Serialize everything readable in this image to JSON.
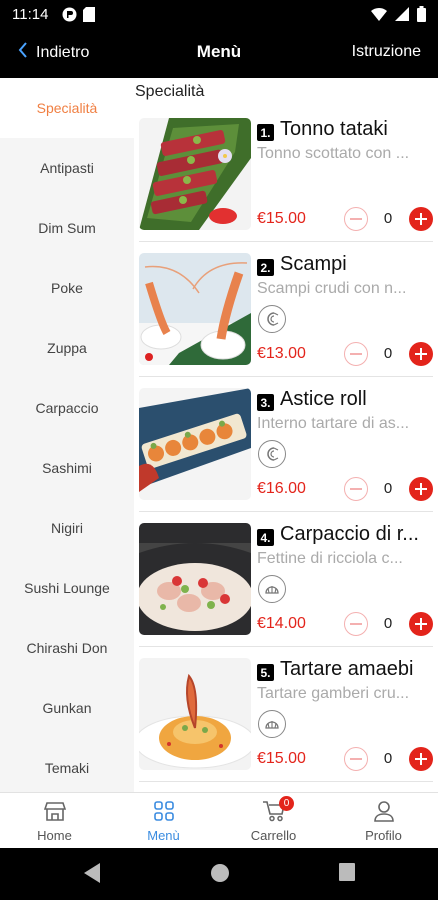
{
  "status_bar": {
    "time": "11:14"
  },
  "header": {
    "back_label": "Indietro",
    "title": "Menù",
    "instructions_label": "Istruzione"
  },
  "sidebar": {
    "items": [
      {
        "label": "Specialità"
      },
      {
        "label": "Antipasti"
      },
      {
        "label": "Dim Sum"
      },
      {
        "label": "Poke"
      },
      {
        "label": "Zuppa"
      },
      {
        "label": "Carpaccio"
      },
      {
        "label": "Sashimi"
      },
      {
        "label": "Nigiri"
      },
      {
        "label": "Sushi Lounge"
      },
      {
        "label": "Chirashi Don"
      },
      {
        "label": "Gunkan"
      },
      {
        "label": "Temaki"
      }
    ]
  },
  "main": {
    "section_title": "Specialità",
    "dishes": [
      {
        "number": "1.",
        "name": "Tonno tataki",
        "description": "Tonno scottato con ...",
        "price": "€15.00",
        "quantity": "0",
        "allergen_icon": ""
      },
      {
        "number": "2.",
        "name": "Scampi",
        "description": "Scampi crudi con n...",
        "price": "€13.00",
        "quantity": "0",
        "allergen_icon": "crustacean-icon"
      },
      {
        "number": "3.",
        "name": "Astice roll",
        "description": "Interno tartare di as...",
        "price": "€16.00",
        "quantity": "0",
        "allergen_icon": "crustacean-icon"
      },
      {
        "number": "4.",
        "name": "Carpaccio di r...",
        "description": "Fettine di ricciola c...",
        "price": "€14.00",
        "quantity": "0",
        "allergen_icon": "shell-icon"
      },
      {
        "number": "5.",
        "name": "Tartare amaebi",
        "description": "Tartare gamberi cru...",
        "price": "€15.00",
        "quantity": "0",
        "allergen_icon": "shell-icon"
      }
    ]
  },
  "tab_bar": {
    "items": [
      {
        "label": "Home",
        "icon": "store-icon"
      },
      {
        "label": "Menù",
        "icon": "grid-icon"
      },
      {
        "label": "Carrello",
        "icon": "cart-icon"
      },
      {
        "label": "Profilo",
        "icon": "user-icon"
      }
    ],
    "cart_count": "0"
  },
  "colors": {
    "accent_orange": "#f07f42",
    "price_red": "#e3241b",
    "tab_active_blue": "#3b8ce0"
  }
}
